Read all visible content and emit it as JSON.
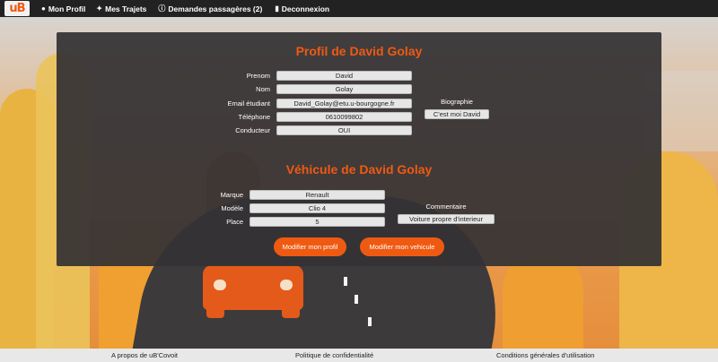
{
  "navbar": {
    "logo": "uB",
    "items": [
      {
        "icon": "user-icon",
        "label": "Mon Profil"
      },
      {
        "icon": "car-icon",
        "label": "Mes Trajets"
      },
      {
        "icon": "info-icon",
        "label": "Demandes passagères (2)"
      },
      {
        "icon": "door-icon",
        "label": "Deconnexion"
      }
    ]
  },
  "profile": {
    "title": "Profil de David Golay",
    "fields": [
      {
        "label": "Prenom",
        "value": "David"
      },
      {
        "label": "Nom",
        "value": "Golay"
      },
      {
        "label": "Email étudiant",
        "value": "David_Golay@etu.u-bourgogne.fr"
      },
      {
        "label": "Téléphone",
        "value": "0610099802"
      },
      {
        "label": "Conducteur",
        "value": "OUI"
      }
    ],
    "biography_label": "Biographie",
    "biography_value": "C'est moi David"
  },
  "vehicle": {
    "title": "Véhicule de David Golay",
    "fields": [
      {
        "label": "Marque",
        "value": "Renault"
      },
      {
        "label": "Modèle",
        "value": "Clio 4"
      },
      {
        "label": "Place",
        "value": "5"
      }
    ],
    "comment_label": "Commentaire",
    "comment_value": "Voiture propre d'interieur"
  },
  "buttons": {
    "edit_profile": "Modifier mon profil",
    "edit_vehicle": "Modifier mon vehicule"
  },
  "footer": {
    "about": "A propos de uB'Covoit",
    "privacy": "Politique de confidentialité",
    "terms": "Conditions générales d'utilisation"
  },
  "colors": {
    "accent": "#ef5a12",
    "navbar": "#222222",
    "panel": "#343234"
  }
}
